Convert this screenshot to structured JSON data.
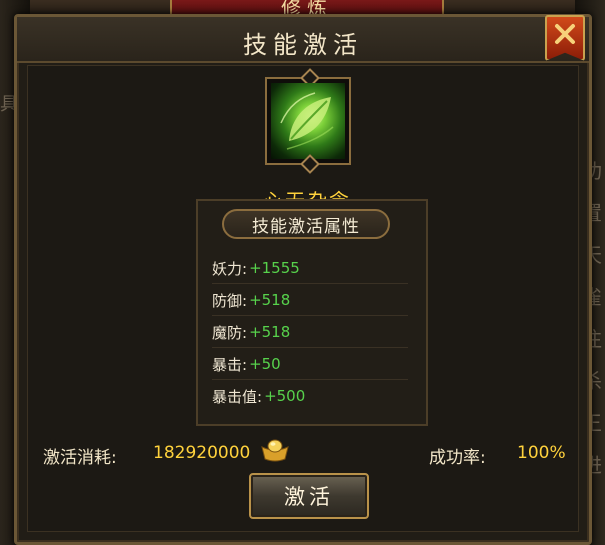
{
  "background": {
    "tab_title": "修炼",
    "right_glyphs": [
      "功",
      "置",
      "天",
      "雀",
      "往",
      "杀",
      "王",
      "进"
    ],
    "left_glyph": "具"
  },
  "dialog": {
    "title": "技能激活",
    "close_icon": "close-x-icon"
  },
  "skill": {
    "icon": "green-leaf-skill-icon",
    "name": "心无杂念"
  },
  "attributes": {
    "title": "技能激活属性",
    "rows": [
      {
        "label": "妖力:",
        "value": "+1555"
      },
      {
        "label": "防御:",
        "value": "+518"
      },
      {
        "label": "魔防:",
        "value": "+518"
      },
      {
        "label": "暴击:",
        "value": "+50"
      },
      {
        "label": "暴击值:",
        "value": "+500"
      }
    ]
  },
  "cost": {
    "label": "激活消耗:",
    "value": "182920000",
    "currency_icon": "gold-ingot-icon"
  },
  "success": {
    "label": "成功率:",
    "value": "100%"
  },
  "activate_button": {
    "label": "激活"
  },
  "colors": {
    "gold_text": "#ffd23c",
    "green_value": "#57d24c",
    "frame": "#8b6d3e"
  }
}
